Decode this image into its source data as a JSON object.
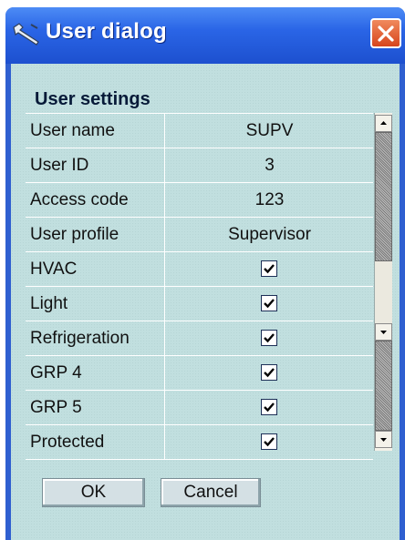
{
  "window": {
    "title": "User dialog",
    "title_icon": "tools-icon",
    "close_icon": "close-icon"
  },
  "section": {
    "label": "User settings"
  },
  "rows": [
    {
      "label": "User name",
      "value": "SUPV",
      "type": "text"
    },
    {
      "label": "User ID",
      "value": "3",
      "type": "text"
    },
    {
      "label": "Access code",
      "value": "123",
      "type": "text"
    },
    {
      "label": "User profile",
      "value": "Supervisor",
      "type": "text"
    },
    {
      "label": "HVAC",
      "checked": true,
      "type": "checkbox"
    },
    {
      "label": "Light",
      "checked": true,
      "type": "checkbox"
    },
    {
      "label": "Refrigeration",
      "checked": true,
      "type": "checkbox"
    },
    {
      "label": "GRP 4",
      "checked": true,
      "type": "checkbox"
    },
    {
      "label": "GRP 5",
      "checked": true,
      "type": "checkbox"
    },
    {
      "label": "Protected",
      "checked": true,
      "type": "checkbox"
    }
  ],
  "buttons": {
    "ok": "OK",
    "cancel": "Cancel"
  },
  "colors": {
    "title_bar": "#2a65e6",
    "client_bg": "#c1dfdf",
    "close_button": "#d7451d"
  }
}
